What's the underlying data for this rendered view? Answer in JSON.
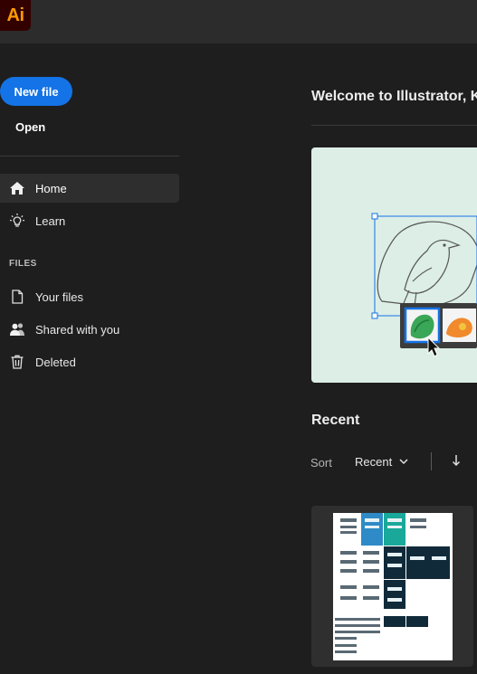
{
  "app": {
    "logo_text": "Ai",
    "brand_color": "#ff9a00"
  },
  "sidebar": {
    "new_file_label": "New file",
    "open_label": "Open",
    "nav": [
      {
        "label": "Home",
        "icon": "home-icon",
        "active": true
      },
      {
        "label": "Learn",
        "icon": "lightbulb-icon"
      }
    ],
    "files_section_label": "FILES",
    "files": [
      {
        "label": "Your files",
        "icon": "document-icon"
      },
      {
        "label": "Shared with you",
        "icon": "users-icon"
      },
      {
        "label": "Deleted",
        "icon": "trash-icon"
      }
    ]
  },
  "main": {
    "welcome_text": "Welcome to Illustrator, K",
    "recent_title": "Recent",
    "sort_label": "Sort",
    "sort_value": "Recent",
    "accent_color": "#1473e6"
  }
}
